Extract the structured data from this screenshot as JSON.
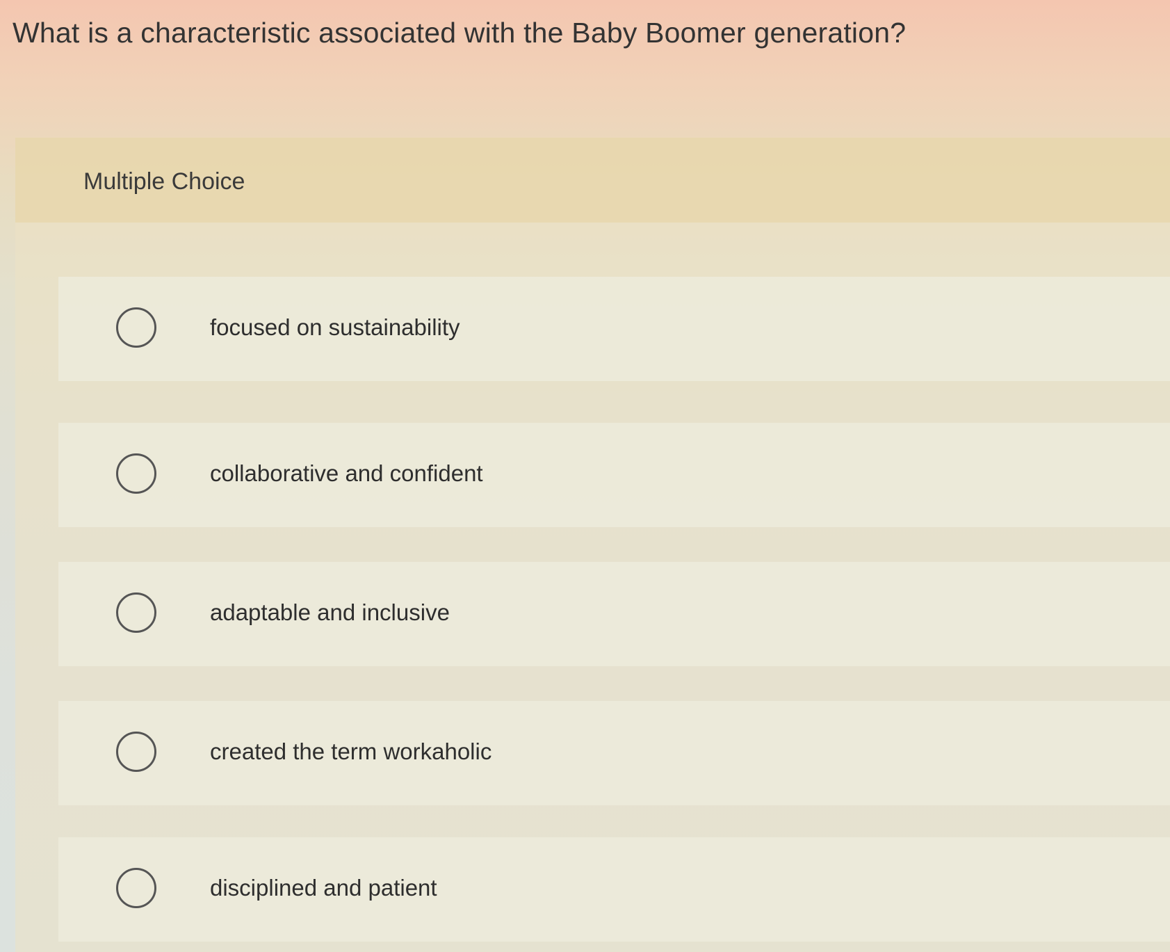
{
  "question": {
    "text": "What is a characteristic associated with the Baby Boomer generation?"
  },
  "panel": {
    "type_label": "Multiple Choice"
  },
  "options": [
    {
      "label": "focused on sustainability",
      "selected": false
    },
    {
      "label": "collaborative and confident",
      "selected": false
    },
    {
      "label": "adaptable and inclusive",
      "selected": false
    },
    {
      "label": "created the term workaholic",
      "selected": false
    },
    {
      "label": "disciplined and patient",
      "selected": false
    }
  ]
}
